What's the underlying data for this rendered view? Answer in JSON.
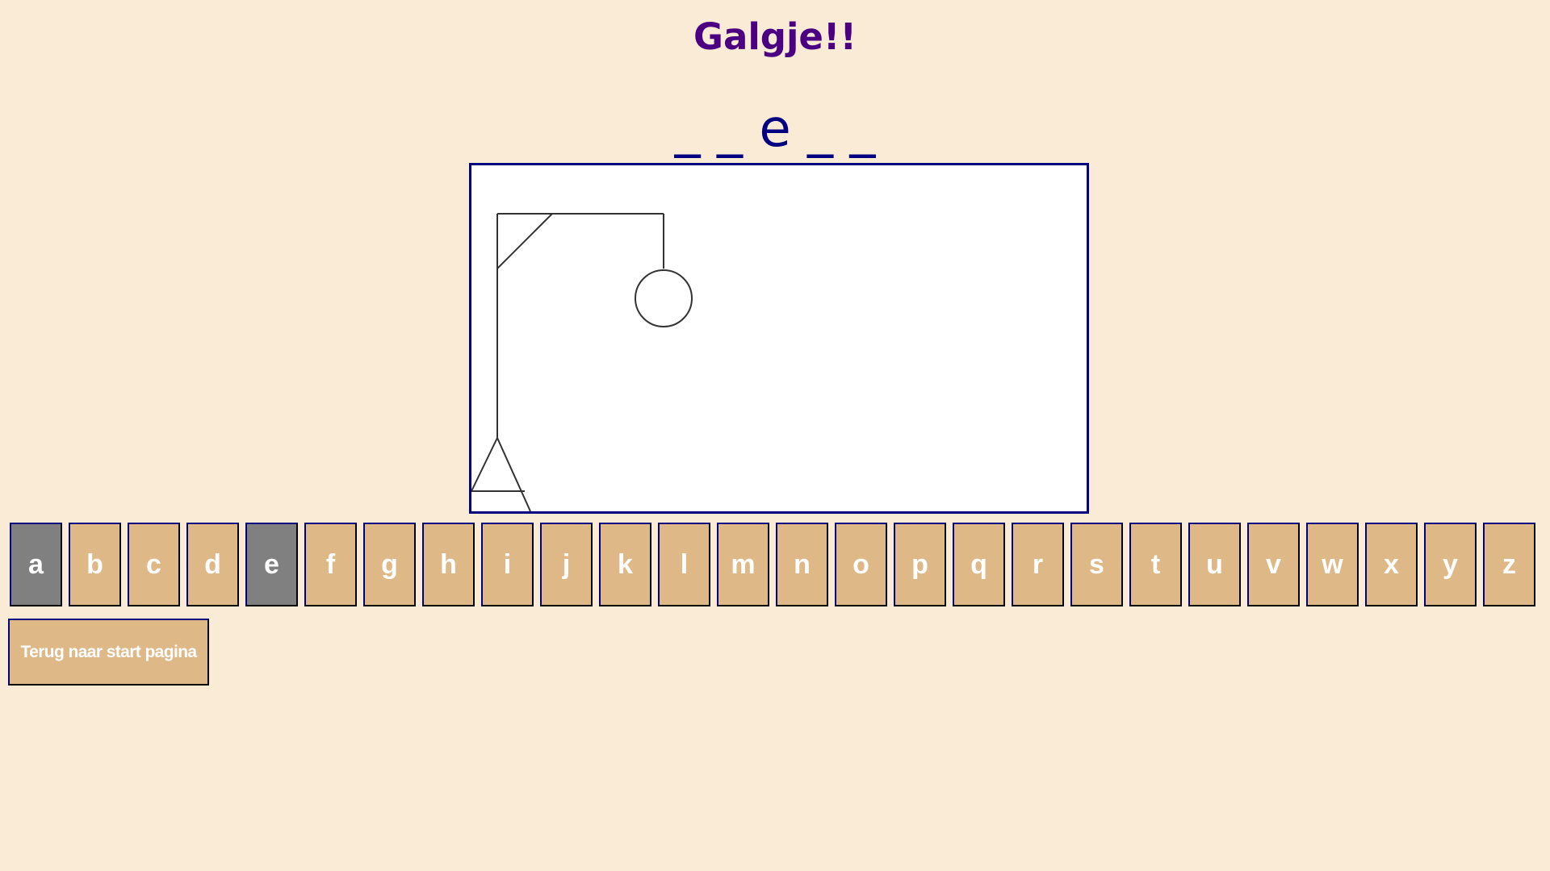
{
  "page": {
    "title": "Galgje!!",
    "word_display": "_ _ e _ _"
  },
  "colors": {
    "background": "#faebd7",
    "title": "#4b0082",
    "word": "#000080",
    "key": "#deb887",
    "key_used": "#808080",
    "key_text": "#ffffff"
  },
  "hangman": {
    "stage_description_parts_visible": [
      "base",
      "pole",
      "top-beam",
      "brace",
      "rope",
      "head"
    ]
  },
  "keyboard": {
    "keys": [
      {
        "letter": "a",
        "used": true
      },
      {
        "letter": "b",
        "used": false
      },
      {
        "letter": "c",
        "used": false
      },
      {
        "letter": "d",
        "used": false
      },
      {
        "letter": "e",
        "used": true
      },
      {
        "letter": "f",
        "used": false
      },
      {
        "letter": "g",
        "used": false
      },
      {
        "letter": "h",
        "used": false
      },
      {
        "letter": "i",
        "used": false
      },
      {
        "letter": "j",
        "used": false
      },
      {
        "letter": "k",
        "used": false
      },
      {
        "letter": "l",
        "used": false
      },
      {
        "letter": "m",
        "used": false
      },
      {
        "letter": "n",
        "used": false
      },
      {
        "letter": "o",
        "used": false
      },
      {
        "letter": "p",
        "used": false
      },
      {
        "letter": "q",
        "used": false
      },
      {
        "letter": "r",
        "used": false
      },
      {
        "letter": "s",
        "used": false
      },
      {
        "letter": "t",
        "used": false
      },
      {
        "letter": "u",
        "used": false
      },
      {
        "letter": "v",
        "used": false
      },
      {
        "letter": "w",
        "used": false
      },
      {
        "letter": "x",
        "used": false
      },
      {
        "letter": "y",
        "used": false
      },
      {
        "letter": "z",
        "used": false
      }
    ]
  },
  "navigation": {
    "back_label": "Terug naar start pagina"
  }
}
